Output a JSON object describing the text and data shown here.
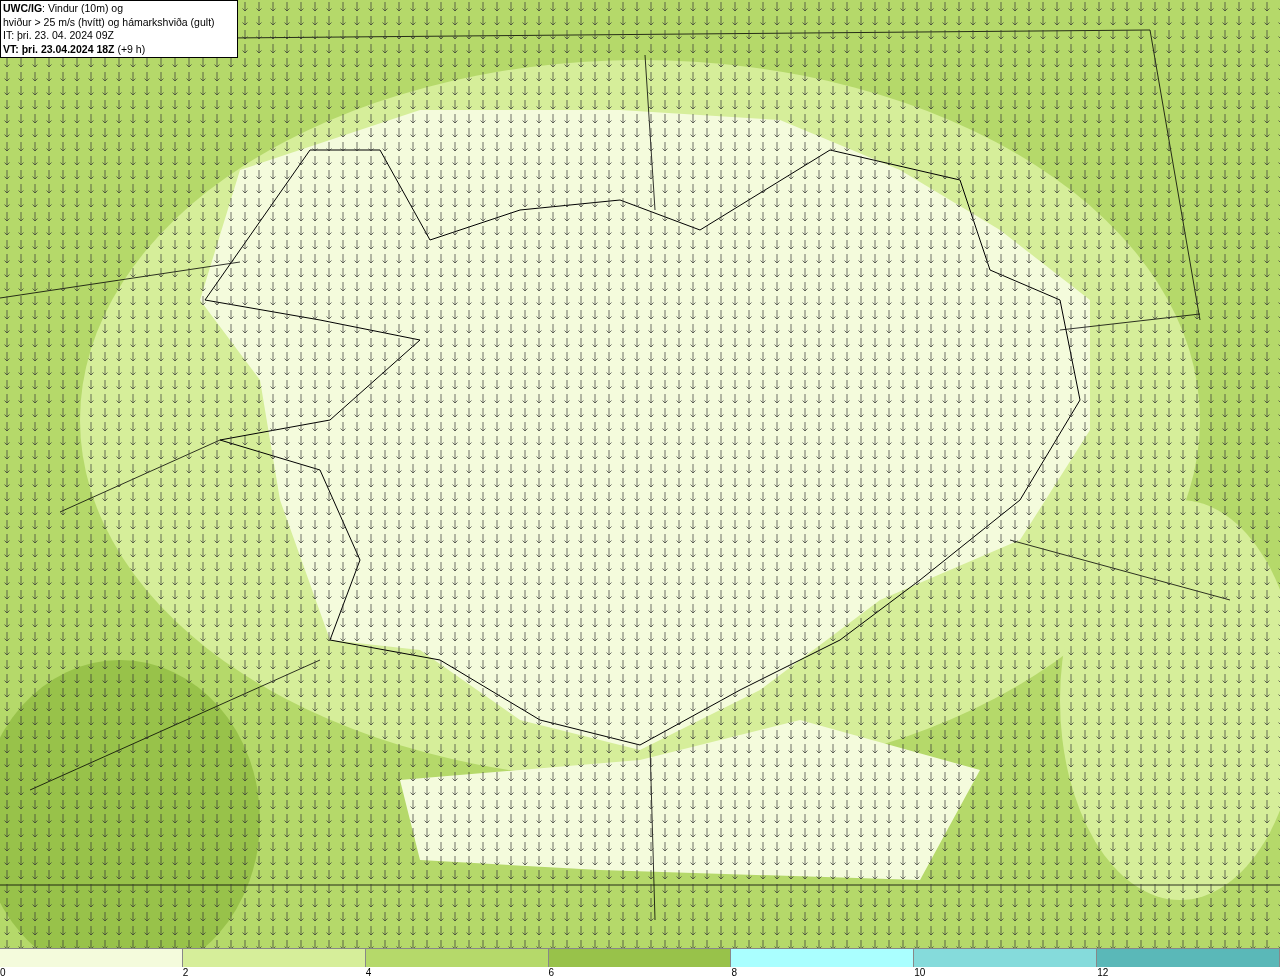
{
  "title_box": {
    "lines": [
      "**UWC/IG**: Vindur (10m) og",
      "hviður > 25 m/s (hvítt) og hámarkshviða (gult)",
      "IT: þri. 23. 04. 2024 09Z",
      "**VT: þri. 23.04.2024 18Z** (+9 h)"
    ]
  },
  "legend": {
    "bins": [
      {
        "color": "#f4fbdc"
      },
      {
        "color": "#d6ee9a"
      },
      {
        "color": "#b5d96a"
      },
      {
        "color": "#98c24a"
      },
      {
        "color": "#aaffff"
      },
      {
        "color": "#85dbdb"
      },
      {
        "color": "#5ab8b8"
      }
    ],
    "ticks": [
      "0",
      "2",
      "4",
      "6",
      "8",
      "10",
      "12"
    ]
  }
}
